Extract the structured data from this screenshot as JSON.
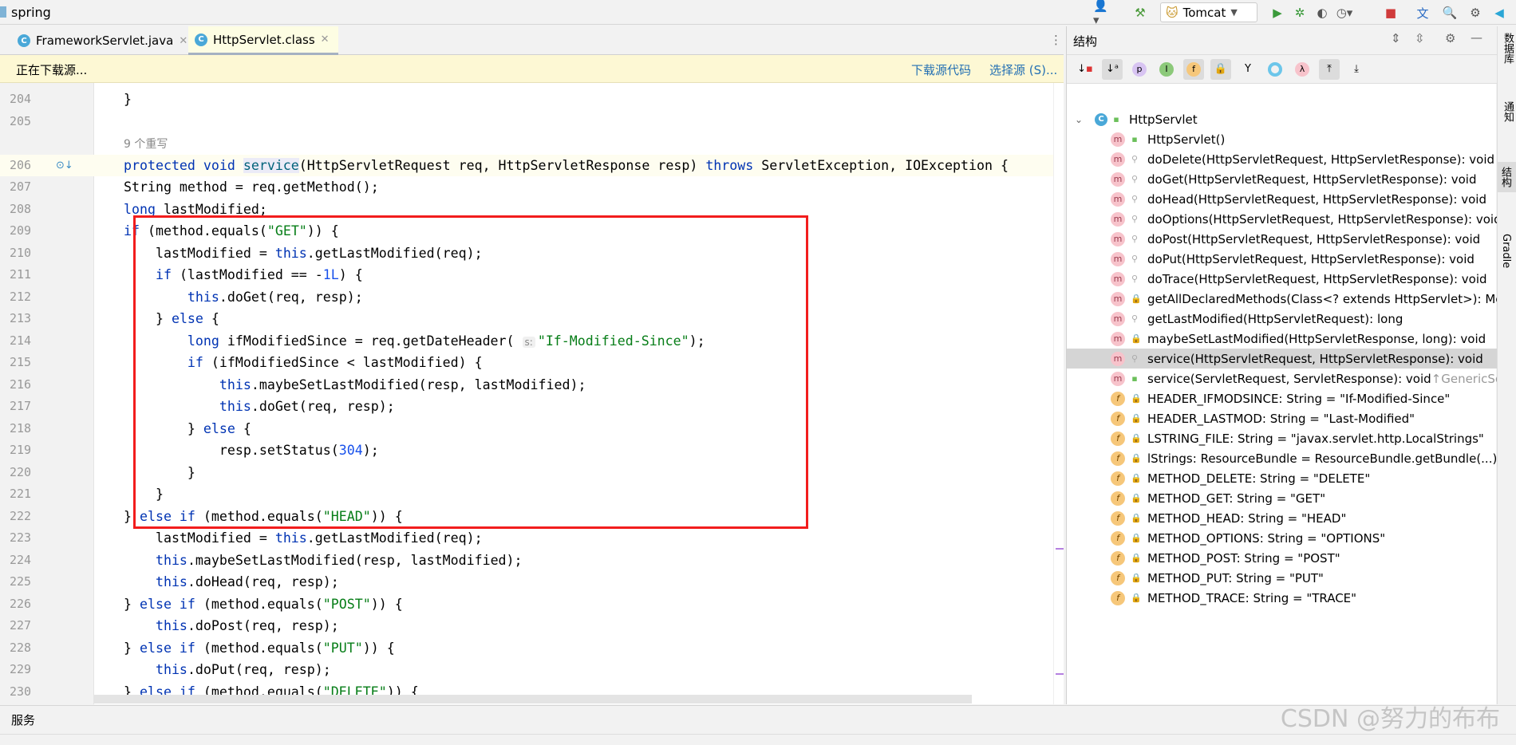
{
  "titlebar": {
    "project": "spring",
    "run_config": "Tomcat"
  },
  "tabs": [
    {
      "label": "FrameworkServlet.java",
      "active": false
    },
    {
      "label": "HttpServlet.class",
      "active": true
    }
  ],
  "banner": {
    "message": "正在下载源...",
    "download_link": "下载源代码",
    "choose_link": "选择源 (S)..."
  },
  "editor": {
    "code_lens": "9 个重写",
    "param_hint": "s:",
    "lines": [
      {
        "n": "204",
        "t": [
          [
            "p",
            "    }"
          ]
        ]
      },
      {
        "n": "205",
        "t": []
      },
      {
        "n": "",
        "lens": true
      },
      {
        "n": "206",
        "t": [
          [
            "kw",
            "protected void "
          ],
          [
            "fn",
            "service"
          ],
          [
            "p",
            "(HttpServletRequest req, HttpServletResponse resp) "
          ],
          [
            "kw",
            "throws"
          ],
          [
            "p",
            " ServletException, IOException {"
          ]
        ]
      },
      {
        "n": "207",
        "t": [
          [
            "p",
            "    String method = req.getMethod();"
          ]
        ]
      },
      {
        "n": "208",
        "t": [
          [
            "kw",
            "    long"
          ],
          [
            "p",
            " lastModified;"
          ]
        ]
      },
      {
        "n": "209",
        "t": [
          [
            "kw",
            "    if"
          ],
          [
            "p",
            " (method.equals("
          ],
          [
            "str",
            "\"GET\""
          ],
          [
            "p",
            ")) {"
          ]
        ]
      },
      {
        "n": "210",
        "t": [
          [
            "p",
            "        lastModified = "
          ],
          [
            "kw",
            "this"
          ],
          [
            "p",
            ".getLastModified(req);"
          ]
        ]
      },
      {
        "n": "211",
        "t": [
          [
            "kw",
            "        if"
          ],
          [
            "p",
            " (lastModified == -"
          ],
          [
            "num",
            "1L"
          ],
          [
            "p",
            ") {"
          ]
        ]
      },
      {
        "n": "212",
        "t": [
          [
            "kw",
            "            this"
          ],
          [
            "p",
            ".doGet(req, resp);"
          ]
        ]
      },
      {
        "n": "213",
        "t": [
          [
            "p",
            "        } "
          ],
          [
            "kw",
            "else"
          ],
          [
            "p",
            " {"
          ]
        ]
      },
      {
        "n": "214",
        "t": [
          [
            "kw",
            "            long"
          ],
          [
            "p",
            " ifModifiedSince = req.getDateHeader( "
          ],
          [
            "hint",
            "s:"
          ],
          [
            "str",
            "\"If-Modified-Since\""
          ],
          [
            "p",
            ");"
          ]
        ]
      },
      {
        "n": "215",
        "t": [
          [
            "kw",
            "            if"
          ],
          [
            "p",
            " (ifModifiedSince < lastModified) {"
          ]
        ]
      },
      {
        "n": "216",
        "t": [
          [
            "kw",
            "                this"
          ],
          [
            "p",
            ".maybeSetLastModified(resp, lastModified);"
          ]
        ]
      },
      {
        "n": "217",
        "t": [
          [
            "kw",
            "                this"
          ],
          [
            "p",
            ".doGet(req, resp);"
          ]
        ]
      },
      {
        "n": "218",
        "t": [
          [
            "p",
            "            } "
          ],
          [
            "kw",
            "else"
          ],
          [
            "p",
            " {"
          ]
        ]
      },
      {
        "n": "219",
        "t": [
          [
            "p",
            "                resp.setStatus("
          ],
          [
            "num",
            "304"
          ],
          [
            "p",
            ");"
          ]
        ]
      },
      {
        "n": "220",
        "t": [
          [
            "p",
            "            }"
          ]
        ]
      },
      {
        "n": "221",
        "t": [
          [
            "p",
            "        }"
          ]
        ]
      },
      {
        "n": "222",
        "t": [
          [
            "p",
            "    } "
          ],
          [
            "kw",
            "else if"
          ],
          [
            "p",
            " (method.equals("
          ],
          [
            "str",
            "\"HEAD\""
          ],
          [
            "p",
            ")) {"
          ]
        ]
      },
      {
        "n": "223",
        "t": [
          [
            "p",
            "        lastModified = "
          ],
          [
            "kw",
            "this"
          ],
          [
            "p",
            ".getLastModified(req);"
          ]
        ]
      },
      {
        "n": "224",
        "t": [
          [
            "kw",
            "        this"
          ],
          [
            "p",
            ".maybeSetLastModified(resp, lastModified);"
          ]
        ]
      },
      {
        "n": "225",
        "t": [
          [
            "kw",
            "        this"
          ],
          [
            "p",
            ".doHead(req, resp);"
          ]
        ]
      },
      {
        "n": "226",
        "t": [
          [
            "p",
            "    } "
          ],
          [
            "kw",
            "else if"
          ],
          [
            "p",
            " (method.equals("
          ],
          [
            "str",
            "\"POST\""
          ],
          [
            "p",
            ")) {"
          ]
        ]
      },
      {
        "n": "227",
        "t": [
          [
            "kw",
            "        this"
          ],
          [
            "p",
            ".doPost(req, resp);"
          ]
        ]
      },
      {
        "n": "228",
        "t": [
          [
            "p",
            "    } "
          ],
          [
            "kw",
            "else if"
          ],
          [
            "p",
            " (method.equals("
          ],
          [
            "str",
            "\"PUT\""
          ],
          [
            "p",
            ")) {"
          ]
        ]
      },
      {
        "n": "229",
        "t": [
          [
            "kw",
            "        this"
          ],
          [
            "p",
            ".doPut(req, resp);"
          ]
        ]
      },
      {
        "n": "230",
        "t": [
          [
            "p",
            "    } "
          ],
          [
            "kw",
            "else if"
          ],
          [
            "p",
            " (method.equals("
          ],
          [
            "str",
            "\"DELETE\""
          ],
          [
            "p",
            ")) {"
          ]
        ]
      }
    ]
  },
  "structure": {
    "title": "结构",
    "root": "HttpServlet",
    "items": [
      {
        "kind": "m",
        "vis": "pub",
        "label": "HttpServlet()"
      },
      {
        "kind": "m",
        "vis": "pkg",
        "label": "doDelete(HttpServletRequest, HttpServletResponse): void"
      },
      {
        "kind": "m",
        "vis": "pkg",
        "label": "doGet(HttpServletRequest, HttpServletResponse): void"
      },
      {
        "kind": "m",
        "vis": "pkg",
        "label": "doHead(HttpServletRequest, HttpServletResponse): void"
      },
      {
        "kind": "m",
        "vis": "pkg",
        "label": "doOptions(HttpServletRequest, HttpServletResponse): void"
      },
      {
        "kind": "m",
        "vis": "pkg",
        "label": "doPost(HttpServletRequest, HttpServletResponse): void"
      },
      {
        "kind": "m",
        "vis": "pkg",
        "label": "doPut(HttpServletRequest, HttpServletResponse): void"
      },
      {
        "kind": "m",
        "vis": "pkg",
        "label": "doTrace(HttpServletRequest, HttpServletResponse): void"
      },
      {
        "kind": "m",
        "vis": "lock",
        "label": "getAllDeclaredMethods(Class<? extends HttpServlet>): Met"
      },
      {
        "kind": "m",
        "vis": "pkg",
        "label": "getLastModified(HttpServletRequest): long"
      },
      {
        "kind": "m",
        "vis": "lock",
        "label": "maybeSetLastModified(HttpServletResponse, long): void"
      },
      {
        "kind": "m",
        "vis": "pkg",
        "label": "service(HttpServletRequest, HttpServletResponse): void",
        "selected": true
      },
      {
        "kind": "m",
        "vis": "pub",
        "label": "service(ServletRequest, ServletResponse): void",
        "inherited": "↑GenericServ"
      },
      {
        "kind": "f",
        "vis": "lock",
        "label": "HEADER_IFMODSINCE: String = \"If-Modified-Since\""
      },
      {
        "kind": "f",
        "vis": "lock",
        "label": "HEADER_LASTMOD: String = \"Last-Modified\""
      },
      {
        "kind": "f",
        "vis": "lock",
        "label": "LSTRING_FILE: String = \"javax.servlet.http.LocalStrings\""
      },
      {
        "kind": "f",
        "vis": "lock",
        "label": "lStrings: ResourceBundle = ResourceBundle.getBundle(...)"
      },
      {
        "kind": "f",
        "vis": "lock",
        "label": "METHOD_DELETE: String = \"DELETE\""
      },
      {
        "kind": "f",
        "vis": "lock",
        "label": "METHOD_GET: String = \"GET\""
      },
      {
        "kind": "f",
        "vis": "lock",
        "label": "METHOD_HEAD: String = \"HEAD\""
      },
      {
        "kind": "f",
        "vis": "lock",
        "label": "METHOD_OPTIONS: String = \"OPTIONS\""
      },
      {
        "kind": "f",
        "vis": "lock",
        "label": "METHOD_POST: String = \"POST\""
      },
      {
        "kind": "f",
        "vis": "lock",
        "label": "METHOD_PUT: String = \"PUT\""
      },
      {
        "kind": "f",
        "vis": "lock",
        "label": "METHOD_TRACE: String = \"TRACE\""
      }
    ]
  },
  "right_stripe": [
    "数据库",
    "通知",
    "结构",
    "Gradle"
  ],
  "bottom": {
    "services": "服务"
  },
  "watermark": "CSDN @努力的布布"
}
